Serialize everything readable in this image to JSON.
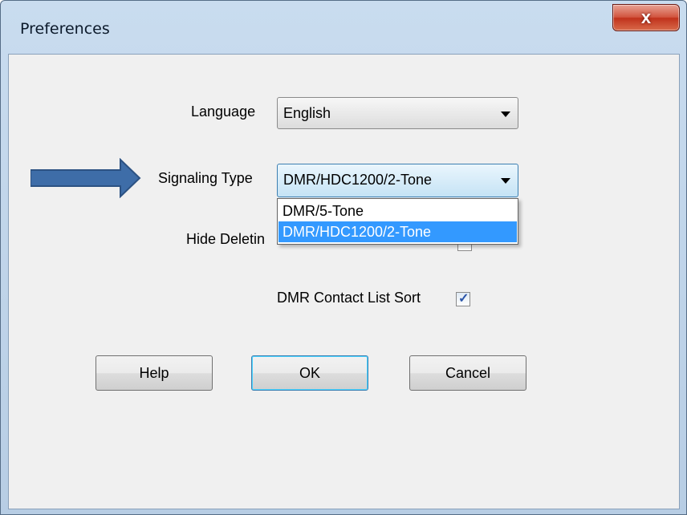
{
  "window": {
    "title": "Preferences",
    "close_symbol": "x"
  },
  "language": {
    "label": "Language",
    "value": "English"
  },
  "signaling": {
    "label": "Signaling Type",
    "value": "DMR/HDC1200/2-Tone",
    "options": [
      "DMR/5-Tone",
      "DMR/HDC1200/2-Tone"
    ],
    "selected_index": 1
  },
  "hide_deleting": {
    "label_visible": "Hide Deletin",
    "checked": false
  },
  "dmr_sort": {
    "label": "DMR Contact List Sort",
    "checked": true
  },
  "buttons": {
    "help": "Help",
    "ok": "OK",
    "cancel": "Cancel"
  },
  "annotation": {
    "icon": "right-arrow-icon",
    "color": "#3e6da8"
  }
}
